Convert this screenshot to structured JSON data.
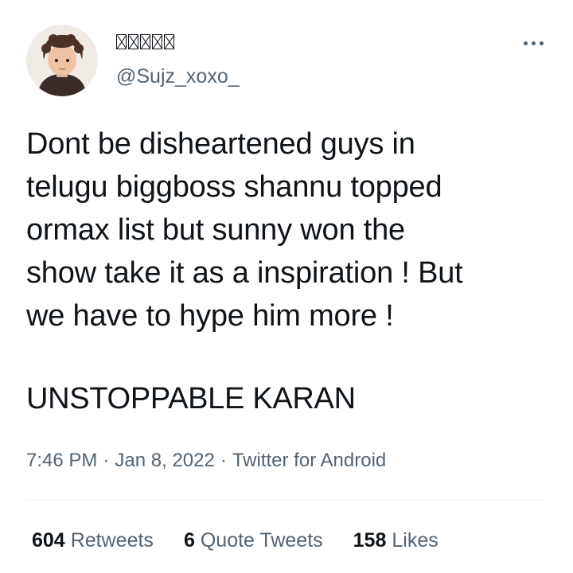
{
  "author": {
    "display_name_glyph_count": 5,
    "handle": "@Sujz_xoxo_",
    "avatar": "child-portrait-avatar"
  },
  "menu": {
    "icon": "more-horizontal-icon"
  },
  "tweet": {
    "body": "Dont be disheartened guys in\ntelugu biggboss shannu topped\normax list but sunny won the\nshow take it as a inspiration ! But\nwe have to hype him more !",
    "tagline": "UNSTOPPABLE KARAN"
  },
  "meta": {
    "time": "7:46 PM",
    "separator": "·",
    "date": "Jan 8, 2022",
    "source": "Twitter for Android"
  },
  "stats": {
    "retweets_count": "604",
    "retweets_label": "Retweets",
    "quotes_count": "6",
    "quotes_label": "Quote Tweets",
    "likes_count": "158",
    "likes_label": "Likes"
  },
  "colors": {
    "text_primary": "#0f1419",
    "text_secondary": "#536471",
    "divider": "#eff3f4"
  }
}
